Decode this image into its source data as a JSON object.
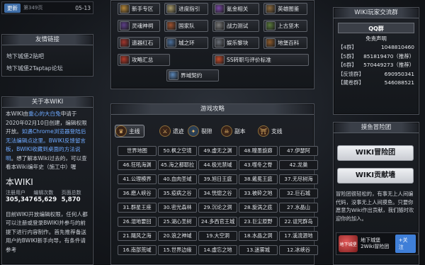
{
  "topbar": {
    "update_label": "更新",
    "page_count": "第349页",
    "date": "05-13"
  },
  "friend_links": {
    "title": "友情链接",
    "items": [
      "地下城堡2贴吧",
      "地下城堡2Taptap论坛"
    ]
  },
  "about": {
    "title": "关于本WIKI",
    "p1_a": "本WIKI由",
    "p1_link": "重心的大白兔",
    "p1_b": "申请于2020年02月10日创建，编辑权限开放。",
    "p1_link2": "如遇Chrome浏览器登陆后无法编辑点这里",
    "p1_link3": "。BWIKI反馈留言板",
    "p1_link4": "，BWIKI收藏到桌面的方法说明",
    "p1_c": "。想了解本Wiki过去的，可以查看本Wiki编年史（施工中）喔",
    "p2": "目前WIKI开放编辑权限，任何人都可以注册或登录BWIKI并参与的前提下进行内容制作。首先推荐备送用户的BWIKI新手向导，有条件请参考"
  },
  "wiki_stats": {
    "title": "本WIKI",
    "labels": [
      "注册用户",
      "编辑次数",
      "页面总数"
    ],
    "values": [
      "305,347",
      "65,629",
      "5,870"
    ]
  },
  "categories": [
    {
      "label": "新手专区",
      "color": "#b5873a"
    },
    {
      "label": "进度指引",
      "color": "#a89b6c"
    },
    {
      "label": "氪金相关",
      "color": "#7a4aa5"
    },
    {
      "label": "英雄图鉴",
      "color": "#8b6a3e"
    },
    {
      "label": "灵魂神祠",
      "color": "#5d3f88"
    },
    {
      "label": "国家队",
      "color": "#9c5230"
    },
    {
      "label": "战力测试",
      "color": "#7c7c7c"
    },
    {
      "label": "上古坚木",
      "color": "#5a7a3c"
    },
    {
      "label": "遗器红石",
      "color": "#a2362e"
    },
    {
      "label": "城之环",
      "color": "#4a6e9a"
    },
    {
      "label": "娱乐黎块",
      "color": "#6a6f78"
    },
    {
      "label": "地堡百科",
      "color": "#8c5a2c"
    },
    {
      "label": "攻略汇总",
      "color": "#b33a2a"
    },
    {
      "label": "SS转职与评价标准",
      "color": "#c24b2c"
    },
    {
      "label": "界域契约",
      "color": "#5b86b8"
    }
  ],
  "guide": {
    "title": "游戏攻略",
    "tabs": [
      {
        "label": "主线",
        "icon": "♛"
      },
      {
        "label": "遗迹",
        "icon": "⚔"
      },
      {
        "label": "裂隙",
        "icon": "✦"
      },
      {
        "label": "副本",
        "icon": "☠"
      },
      {
        "label": "支线",
        "icon": "⛩"
      }
    ],
    "zones": [
      [
        "世界地图",
        "50.枫之空境",
        "49.虚无之渊",
        "48.瞳墨旋廊",
        "47.伊瑟阿"
      ],
      [
        "46.狂吼海渊",
        "45.海之都耶拉",
        "44.极光禁域",
        "43.噬冬之脊",
        "42.龙巢"
      ],
      [
        "41.公理模界",
        "40.血肉圣域",
        "39.旭日王庭",
        "38.戴冕王庭",
        "37.无尽树海"
      ],
      [
        "36.磨人峡谷",
        "35.疫病之谷",
        "34.恍惚之谷",
        "33.被砕之地",
        "32.巨石城"
      ],
      [
        "31.群星王座",
        "30.密光森林",
        "29.沉论之洞",
        "28.旋涡之底",
        "27.水晶山"
      ],
      [
        "26.湿地要回",
        "25.湖心圣树",
        "24.多西官王城",
        "23.巨尘原野",
        "22.诅咒群岛"
      ],
      [
        "21.飓风之海",
        "20.浪之神域",
        "19.大空洞",
        "18.水晶之洞",
        "17.溪流源地"
      ],
      [
        "16.南部荒域",
        "15.世界边缘",
        "14.虚忘之地",
        "13.迷雾城",
        "12.冰峡谷"
      ]
    ]
  },
  "qq": {
    "title": "WIKI玩家交流群",
    "subtitle": "QQ群",
    "disclaimer": "免责声明",
    "groups": [
      {
        "k": "【4群】",
        "n": "1048810460"
      },
      {
        "k": "【5群】",
        "n": "851819470（推荐）"
      },
      {
        "k": "【6群】",
        "n": "570449273（推荐）"
      },
      {
        "k": "【反馈群】",
        "n": "690950341"
      },
      {
        "k": "【藏卷群】",
        "n": "546088521"
      }
    ]
  },
  "recruit": {
    "title": "摸鱼冒险团",
    "btn1": "WIKI冒险团",
    "btn2": "WIKI贡献墙",
    "text": "冒险团很轻松的，有事无上人间编代码，没事无上人间摸鱼。只要你愿意为Wiki作出贡献，我们随时欢迎你的加入。",
    "follow_name": "地下城堡2Wiki冒险团",
    "follow_logo": "地下城堡",
    "follow_btn": "+关注"
  }
}
